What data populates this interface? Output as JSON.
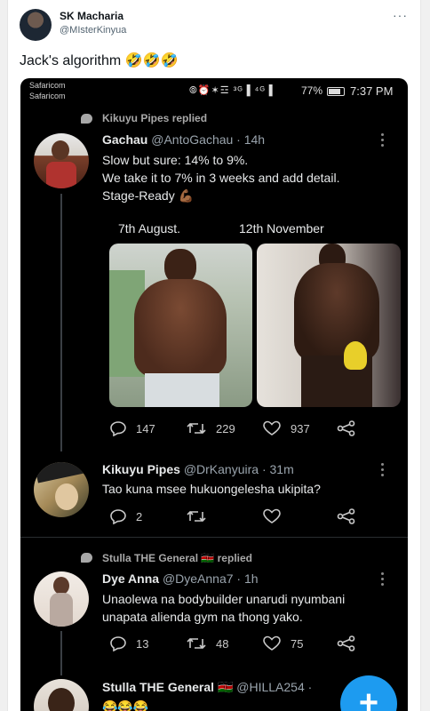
{
  "outer_tweet": {
    "name": "SK Macharia",
    "handle": "@MIsterKinyua",
    "more": "···",
    "text": "Jack's algorithm 🤣🤣🤣"
  },
  "status_bar": {
    "carrier1": "Safaricom",
    "carrier2": "Safaricom",
    "icons": "⦾⏰✶☲ ³ᴳ▐ ⁴ᴳ▐",
    "battery": "77%",
    "time": "7:37 PM"
  },
  "tweet1": {
    "context": "Kikuyu Pipes replied",
    "name": "Gachau",
    "handle": "@AntoGachau · 14h",
    "lines": [
      "Slow but sure: 14% to 9%.",
      "We take it to 7% in 3 weeks and add detail.",
      "Stage-Ready 💪🏾"
    ],
    "date_left": "7th August.",
    "date_right": "12th November",
    "replies": "147",
    "retweets": "229",
    "likes": "937"
  },
  "tweet2": {
    "name": "Kikuyu Pipes",
    "handle": "@DrKanyuira · 31m",
    "text": "Tao kuna msee hukuongelesha ukipita?",
    "replies": "2"
  },
  "tweet3": {
    "context": "Stulla THE General 🇰🇪 replied",
    "name": "Dye Anna",
    "handle": "@DyeAnna7 · 1h",
    "lines": [
      "Unaolewa na bodybuilder unarudi nyumbani",
      "unapata alienda gym na thong yako."
    ],
    "replies": "13",
    "retweets": "48",
    "likes": "75"
  },
  "tweet4": {
    "name": "Stulla THE General",
    "flag": "🇰🇪",
    "handle": "@HILLA254 · ",
    "text": "😂😂😂"
  },
  "fab": "+"
}
